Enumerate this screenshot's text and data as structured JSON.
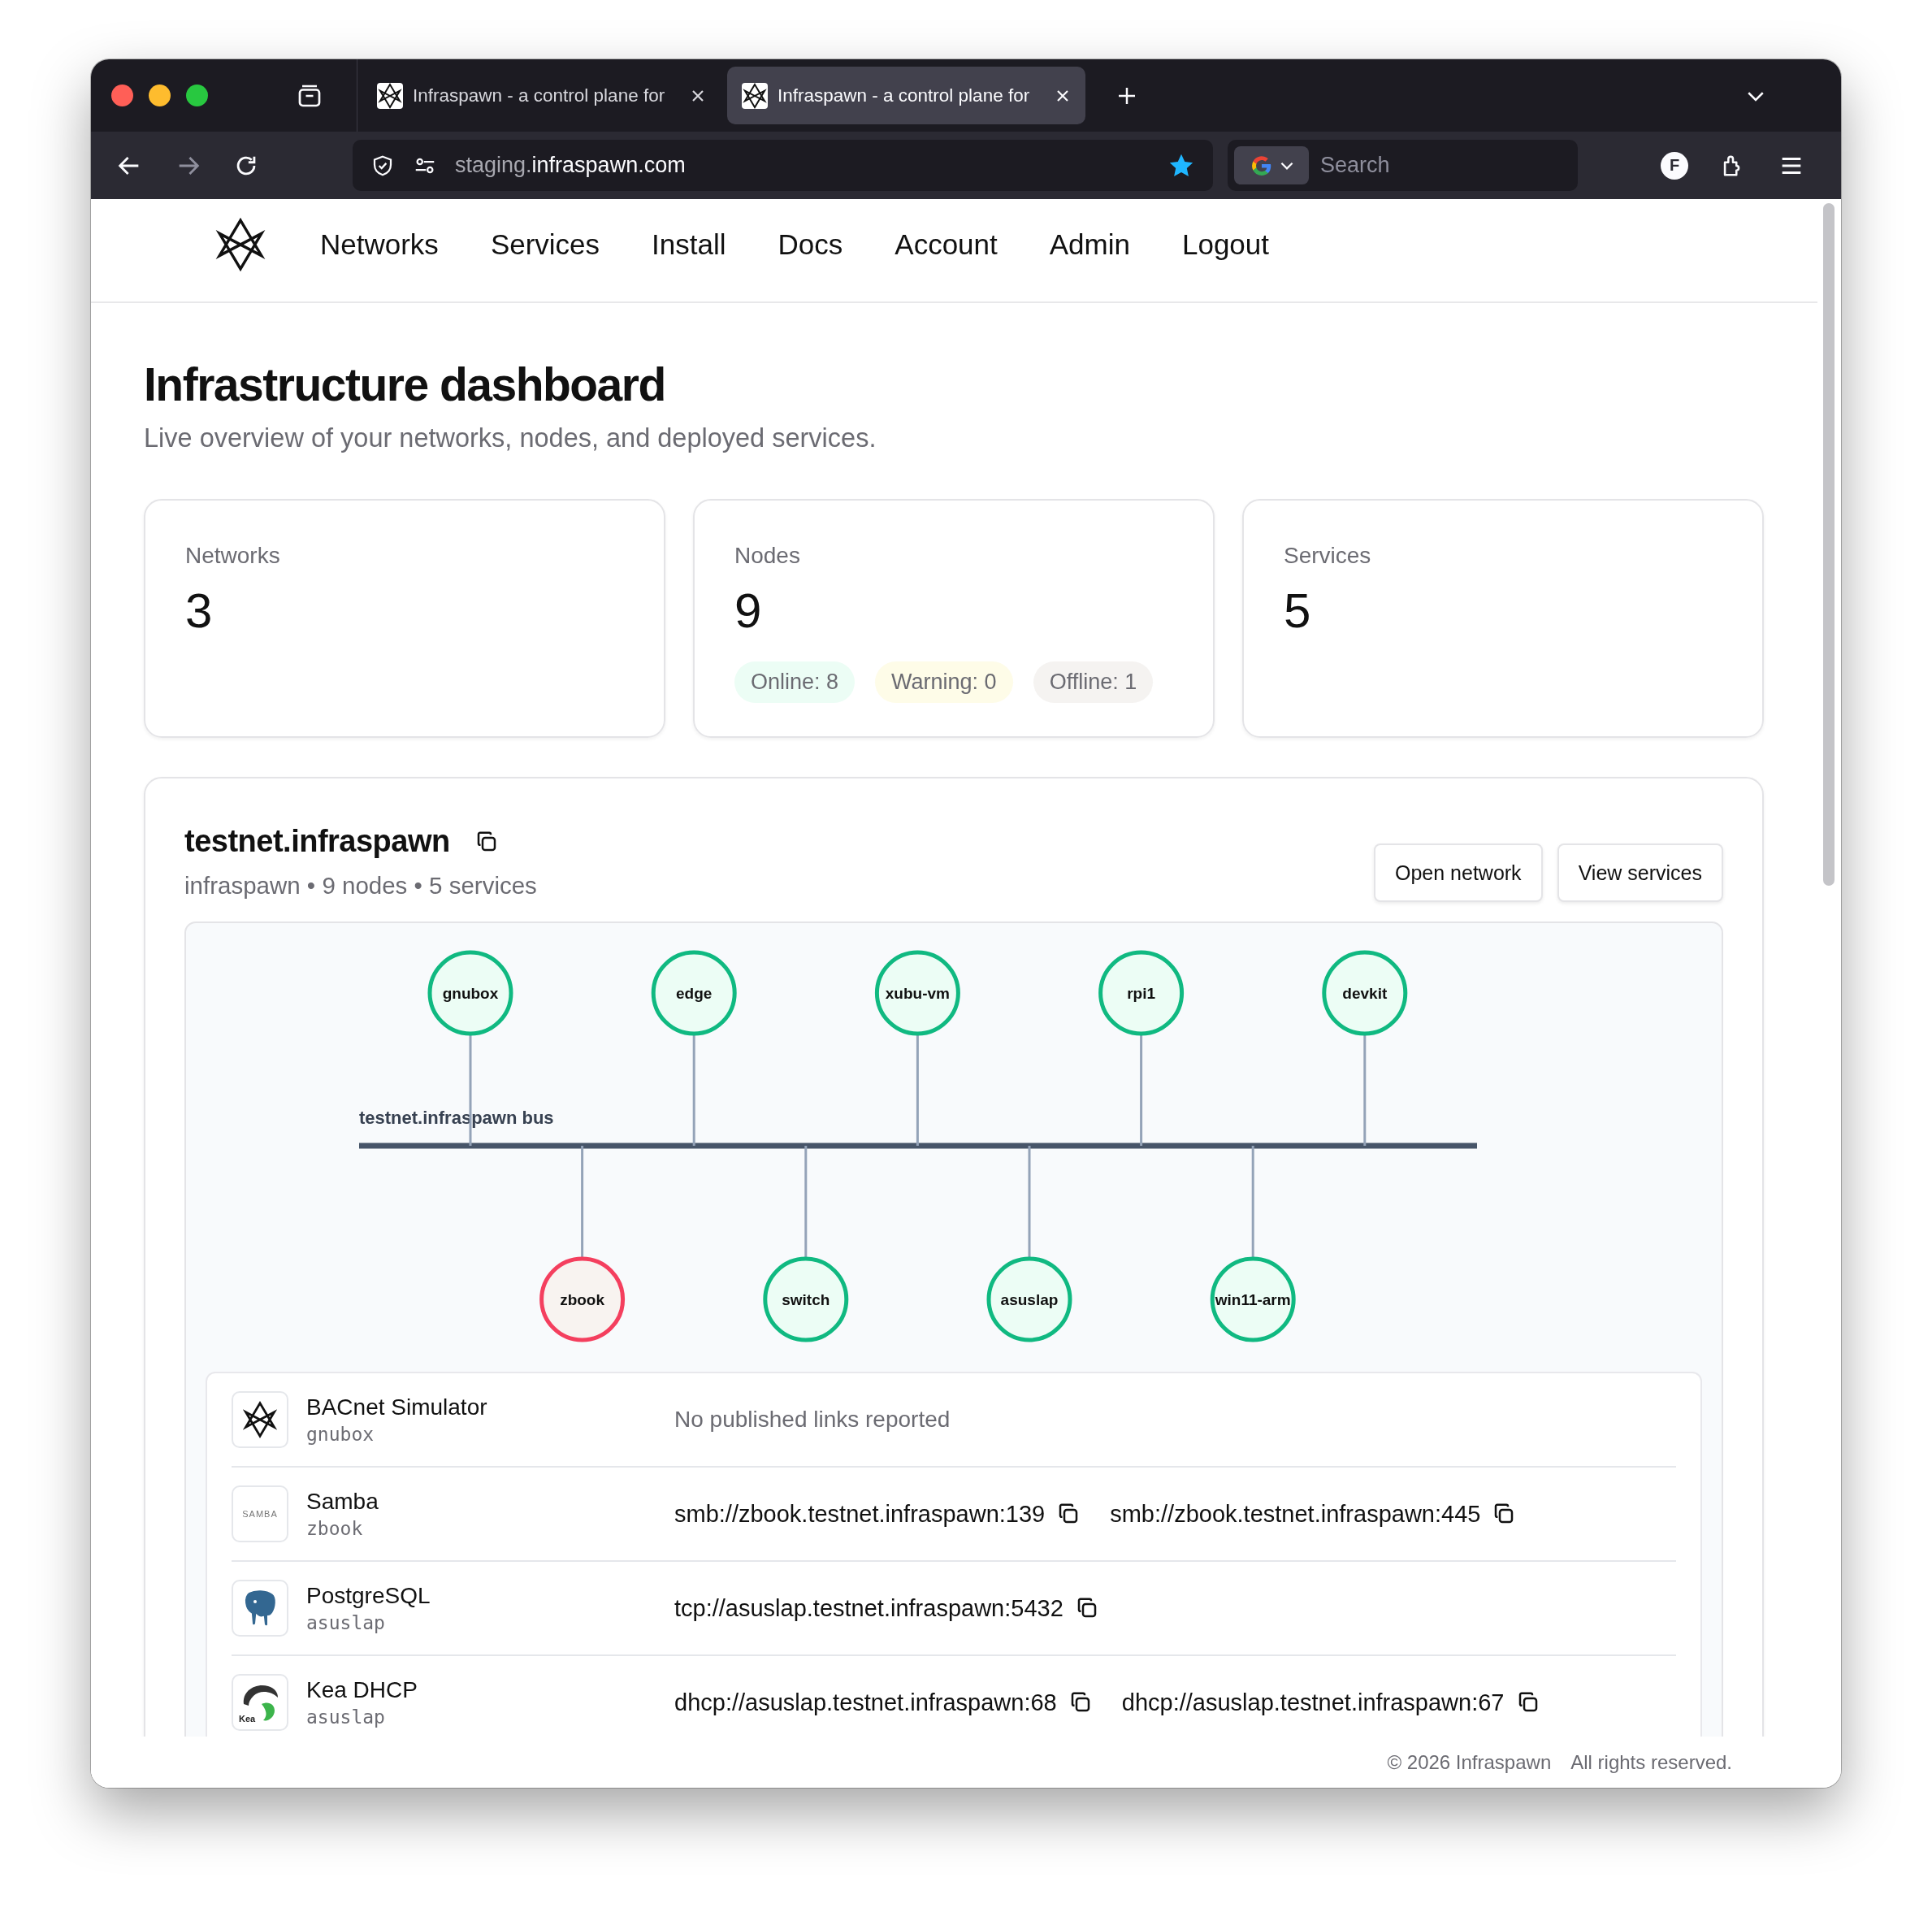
{
  "browser": {
    "tabs": [
      {
        "title": "Infraspawn - a control plane for",
        "selected": false
      },
      {
        "title": "Infraspawn - a control plane for",
        "selected": true
      }
    ],
    "url": {
      "subdomain": "staging.",
      "domain": "infraspawn.com"
    },
    "bookmarked": true,
    "search": {
      "placeholder": "Search"
    },
    "account_initial": "F"
  },
  "nav": {
    "items": [
      "Networks",
      "Services",
      "Install",
      "Docs",
      "Account",
      "Admin",
      "Logout"
    ]
  },
  "header": {
    "title": "Infrastructure dashboard",
    "subtitle": "Live overview of your networks, nodes, and deployed services."
  },
  "stats": [
    {
      "label": "Networks",
      "value": "3"
    },
    {
      "label": "Nodes",
      "value": "9",
      "badges": [
        {
          "text": "Online: 8",
          "color": "#ecfdf5"
        },
        {
          "text": "Warning: 0",
          "color": "#fefce8"
        },
        {
          "text": "Offline: 1",
          "color": "#f5f3f1"
        }
      ]
    },
    {
      "label": "Services",
      "value": "5"
    }
  ],
  "network": {
    "name": "testnet.infraspawn",
    "meta": "infraspawn • 9 nodes • 5 services",
    "buttons": [
      "Open network",
      "View services"
    ],
    "bus_label": "testnet.infraspawn bus",
    "nodes": [
      {
        "name": "gnubox",
        "offline": false
      },
      {
        "name": "zbook",
        "offline": true
      },
      {
        "name": "edge",
        "offline": false
      },
      {
        "name": "switch",
        "offline": false
      },
      {
        "name": "xubu-vm",
        "offline": false
      },
      {
        "name": "asuslap",
        "offline": false
      },
      {
        "name": "rpi1",
        "offline": false
      },
      {
        "name": "win11-arm",
        "offline": false
      },
      {
        "name": "devkit",
        "offline": false
      }
    ],
    "services": [
      {
        "name": "BACnet Simulator",
        "host": "gnubox",
        "kind": "hexagram",
        "empty_text": "No published links reported"
      },
      {
        "name": "Samba",
        "host": "zbook",
        "kind": "samba",
        "logo_text": "SAMBA",
        "links": [
          "smb://zbook.testnet.infraspawn:139",
          "smb://zbook.testnet.infraspawn:445"
        ]
      },
      {
        "name": "PostgreSQL",
        "host": "asuslap",
        "kind": "elephant",
        "links": [
          "tcp://asuslap.testnet.infraspawn:5432"
        ]
      },
      {
        "name": "Kea DHCP",
        "host": "asuslap",
        "kind": "kea",
        "logo_text": "Kea",
        "links": [
          "dhcp://asuslap.testnet.infraspawn:68",
          "dhcp://asuslap.testnet.infraspawn:67"
        ]
      }
    ]
  },
  "footer": {
    "copyright": "© 2026 Infraspawn",
    "rights": "All rights reserved."
  }
}
